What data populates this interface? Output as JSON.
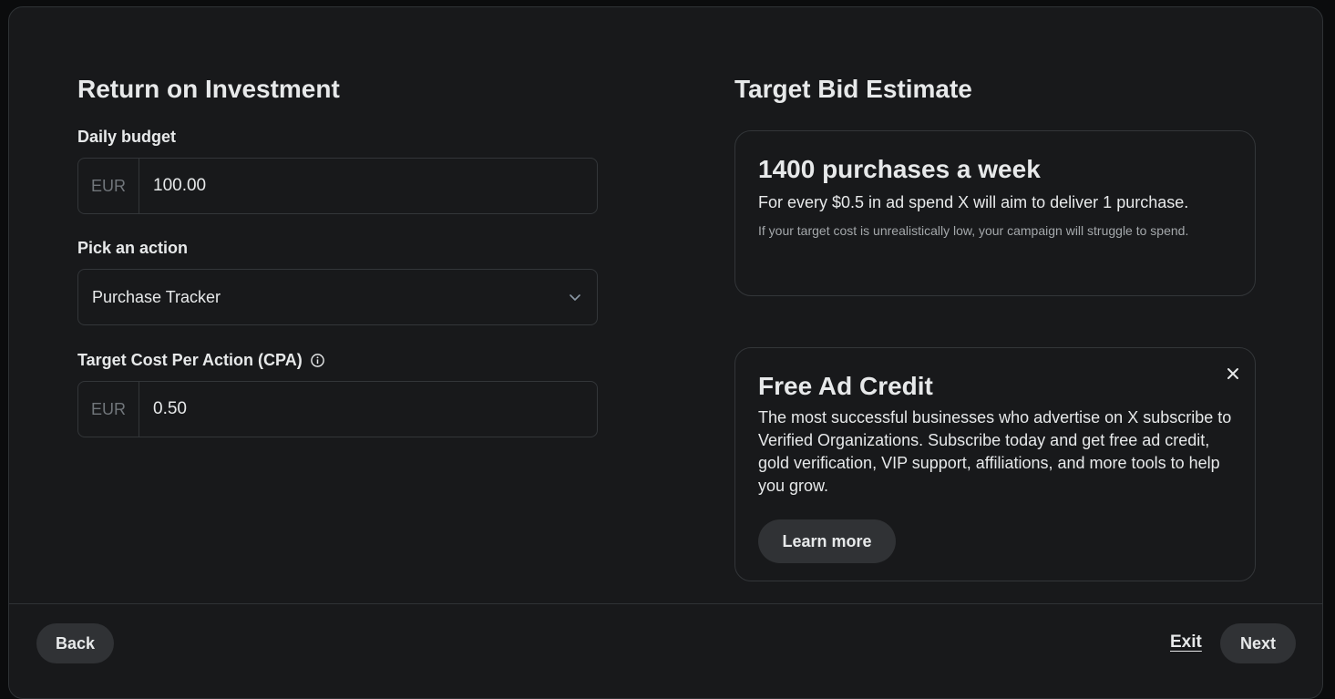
{
  "roi": {
    "title": "Return on Investment",
    "daily_budget": {
      "label": "Daily budget",
      "currency": "EUR",
      "value": "100.00"
    },
    "action": {
      "label": "Pick an action",
      "selected": "Purchase Tracker"
    },
    "cpa": {
      "label": "Target Cost Per Action (CPA)",
      "currency": "EUR",
      "value": "0.50"
    }
  },
  "estimate": {
    "title": "Target Bid Estimate",
    "headline": "1400 purchases a week",
    "body": "For every $0.5 in ad spend X will aim to deliver 1 purchase.",
    "note": "If your target cost is unrealistically low, your campaign will struggle to spend."
  },
  "promo": {
    "title": "Free Ad Credit",
    "body": "The most successful businesses who advertise on X subscribe to Verified Organizations. Subscribe today and get free ad credit, gold verification, VIP support, affiliations, and more tools to help you grow.",
    "button_label": "Learn more"
  },
  "footer": {
    "back_label": "Back",
    "exit_label": "Exit",
    "next_label": "Next"
  }
}
